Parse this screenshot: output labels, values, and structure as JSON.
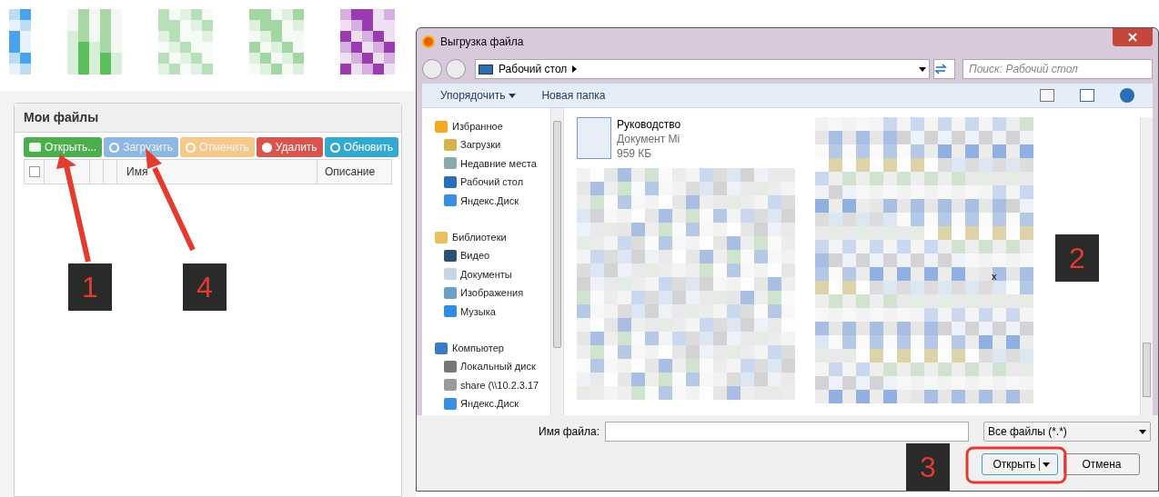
{
  "web_page": {
    "panel_title": "Мои файлы",
    "toolbar": [
      {
        "label": "Открыть...",
        "color": "#4cae4c",
        "disabled": false
      },
      {
        "label": "Загрузить",
        "color": "#8fb8e0",
        "disabled": true
      },
      {
        "label": "Отменить",
        "color": "#f5c98a",
        "disabled": true
      },
      {
        "label": "Удалить",
        "color": "#d9534f",
        "disabled": false
      },
      {
        "label": "Обновить",
        "color": "#31a9d0",
        "disabled": false
      }
    ],
    "table": {
      "select_all_checked": false,
      "columns": [
        "Имя",
        "Описание"
      ]
    }
  },
  "dialog": {
    "title": "Выгрузка файла",
    "address": "Рабочий стол",
    "search": {
      "placeholder": "Поиск: Рабочий стол"
    },
    "toolbar": [
      "Упорядочить",
      "Новая папка"
    ],
    "navigation": [
      {
        "label": "Избранное",
        "children": [
          {
            "label": "Загрузки"
          },
          {
            "label": "Недавние места"
          },
          {
            "label": "Рабочий стол"
          },
          {
            "label": "Яндекс.Диск"
          }
        ]
      },
      {
        "label": "Библиотеки",
        "children": [
          {
            "label": "Видео"
          },
          {
            "label": "Документы"
          },
          {
            "label": "Изображения"
          },
          {
            "label": "Музыка"
          }
        ]
      },
      {
        "label": "Компьютер",
        "children": [
          {
            "label": "Локальный диск"
          },
          {
            "label": "share (\\\\10.2.3.17"
          },
          {
            "label": "Яндекс.Диск"
          }
        ]
      }
    ],
    "file": {
      "name": "Руководство",
      "type": "Документ Mi",
      "size": "959 КБ"
    },
    "stray_text": "x",
    "file_name": {
      "label": "Имя файла:"
    },
    "filter": "Все файлы (*.*)",
    "buttons": [
      "Открыть",
      "Отмена"
    ]
  },
  "annotations": [
    "1",
    "4",
    "2",
    "3"
  ]
}
